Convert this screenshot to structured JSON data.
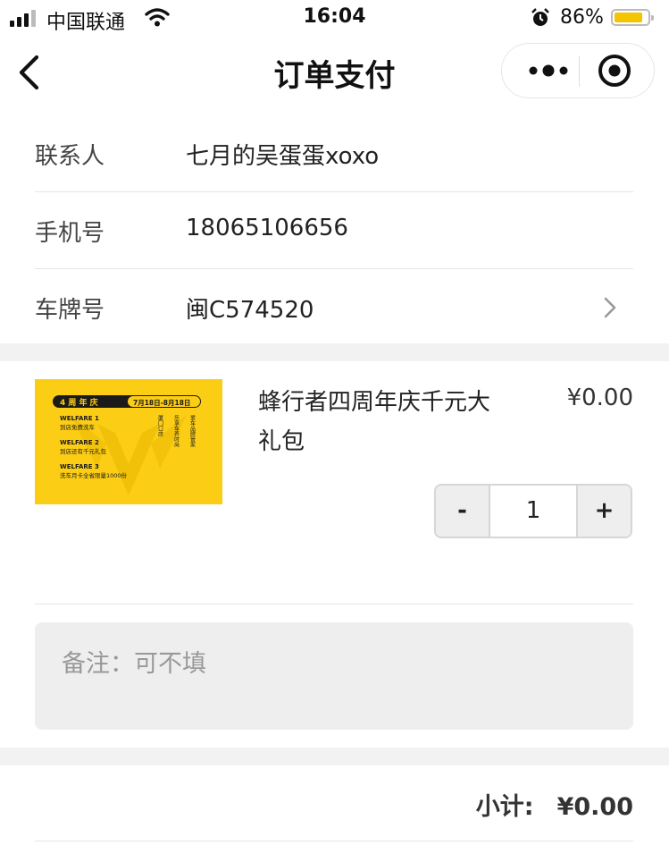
{
  "status_bar": {
    "carrier": "中国联通",
    "time": "16:04",
    "battery": "86%",
    "battery_level": 0.86
  },
  "nav": {
    "title": "订单支付"
  },
  "contact": {
    "name_label": "联系人",
    "name_value": "七月的吴蛋蛋xoxo",
    "phone_label": "手机号",
    "phone_value": "18065106656",
    "plate_label": "车牌号",
    "plate_value": "闽C574520"
  },
  "product": {
    "name": "蜂行者四周年庆千元大礼包",
    "price": "¥0.00",
    "quantity": "1",
    "minus_label": "-",
    "plus_label": "+",
    "image": {
      "badge": "4 周 年 庆",
      "date": "7月18日-8月18日",
      "welfare1_title": "WELFARE 1",
      "welfare1_text": "到店免费洗车",
      "welfare2_title": "WELFARE 2",
      "welfare2_text": "到店还有千元礼包",
      "welfare3_title": "WELFARE 3",
      "welfare3_text": "洗车月卡全省限量1000份",
      "col1": "厦门口店",
      "col2": "乐享车养时尚",
      "col3": "爱车品牌管家"
    }
  },
  "remark": {
    "placeholder": "备注：可不填"
  },
  "summary": {
    "subtotal_label": "小计:",
    "subtotal_value": "¥0.00"
  },
  "colors": {
    "brand_yellow": "#fccd15",
    "gap_gray": "#f2f2f2"
  }
}
